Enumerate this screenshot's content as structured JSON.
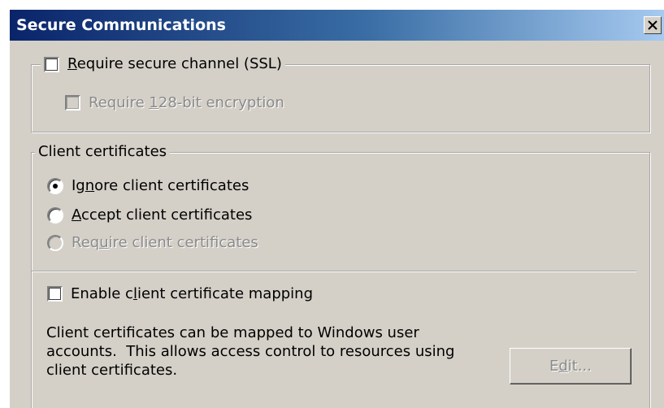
{
  "window": {
    "title": "Secure Communications",
    "close_glyph": "×"
  },
  "ssl_group": {
    "require_ssl": {
      "pre": "",
      "accel": "R",
      "post": "equire secure channel (SSL)",
      "checked": false,
      "enabled": true
    },
    "require_128": {
      "pre": "Require ",
      "accel": "1",
      "post": "28-bit encryption",
      "checked": false,
      "enabled": false
    }
  },
  "client_cert_group": {
    "legend": "Client certificates",
    "options": [
      {
        "pre": "Ig",
        "accel": "n",
        "post": "ore client certificates",
        "selected": true,
        "enabled": true
      },
      {
        "pre": "",
        "accel": "A",
        "post": "ccept client certificates",
        "selected": false,
        "enabled": true
      },
      {
        "pre": "Req",
        "accel": "u",
        "post": "ire client certificates",
        "selected": false,
        "enabled": false
      }
    ]
  },
  "mapping": {
    "enable": {
      "pre": "Enable c",
      "accel": "l",
      "post": "ient certificate mapping",
      "checked": false,
      "enabled": true
    },
    "description_lines": [
      "Client certificates can be mapped to Windows user",
      "accounts.  This allows access control to resources using",
      "client certificates."
    ],
    "edit_button": {
      "pre": "E",
      "accel": "d",
      "post": "it...",
      "enabled": false
    }
  },
  "colors": {
    "face": "#d4d0c8",
    "title_start": "#0a246a",
    "title_end": "#a6caf0",
    "disabled_text": "#8a8a8a"
  }
}
